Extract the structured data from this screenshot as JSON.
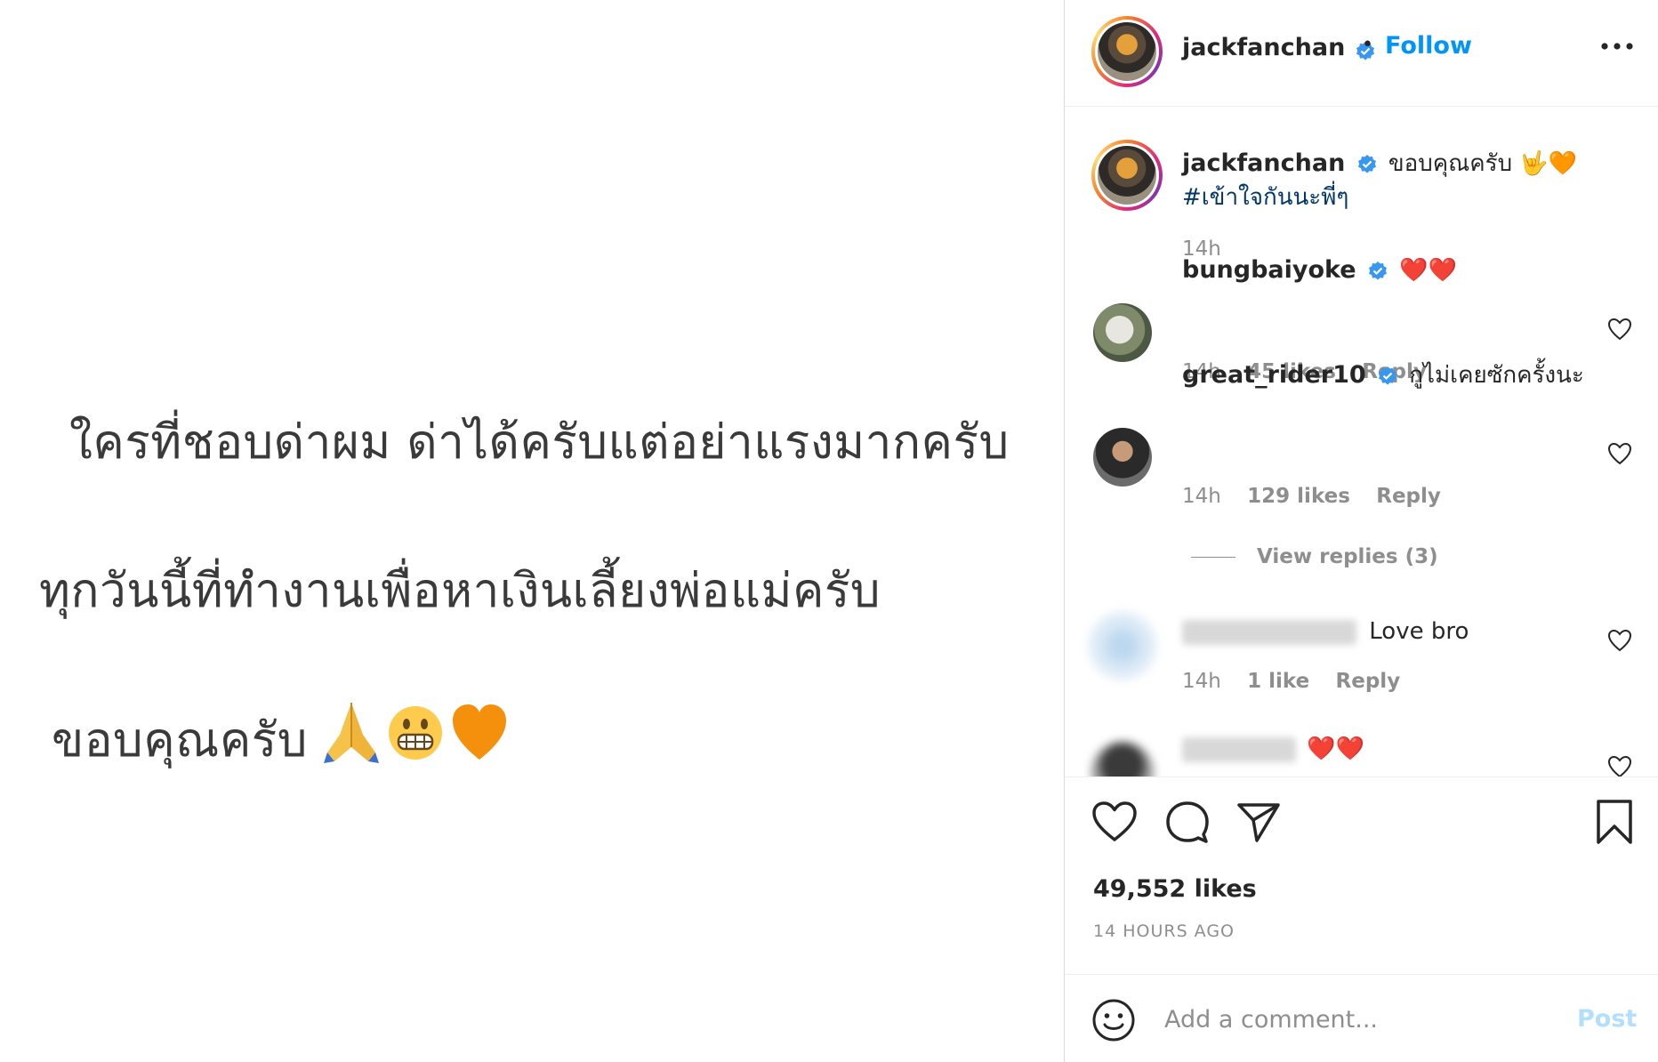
{
  "media": {
    "line1": "ใครที่ชอบด่าผม ด่าได้ครับแต่อย่าแรงมากครับ",
    "line2": "ทุกวันนี้ที่ทำงานเพื่อหาเงินเลี้ยงพ่อแม่ครับ",
    "line3": "ขอบคุณครับ",
    "emojis": [
      "folded-hands",
      "grimacing-face",
      "orange-heart"
    ]
  },
  "header": {
    "username": "jackfanchan",
    "verified": true,
    "separator": "•",
    "follow_label": "Follow",
    "more_icon": "more-horizontal-icon"
  },
  "caption": {
    "username": "jackfanchan",
    "text": "ขอบคุณครับ 🤟🧡",
    "hashtag": "#เข้าใจกันนะพี่ๆ",
    "time": "14h"
  },
  "comments": [
    {
      "username": "bungbaiyoke",
      "verified": true,
      "text": "❤️❤️",
      "time": "14h",
      "likes": "45 likes",
      "reply": "Reply"
    },
    {
      "username": "great_rider10",
      "verified": true,
      "text": "กูไม่เคยซักครั้งนะ",
      "time": "14h",
      "likes": "129 likes",
      "reply": "Reply",
      "view_replies": "View replies (3)"
    },
    {
      "username": "",
      "blurred": true,
      "text": "Love bro",
      "time": "14h",
      "likes": "1 like",
      "reply": "Reply"
    },
    {
      "username": "",
      "blurred": true,
      "text": "❤️❤️"
    }
  ],
  "actions": {
    "likes": "49,552 likes",
    "time_ago": "14 HOURS AGO"
  },
  "add_comment": {
    "placeholder": "Add a comment...",
    "post_label": "Post"
  },
  "colors": {
    "link_blue": "#0095f6",
    "post_disabled": "#b2dffc",
    "muted": "#8e8e8e",
    "text": "#262626",
    "hashtag": "#00376b",
    "verified": "#3897f0"
  }
}
